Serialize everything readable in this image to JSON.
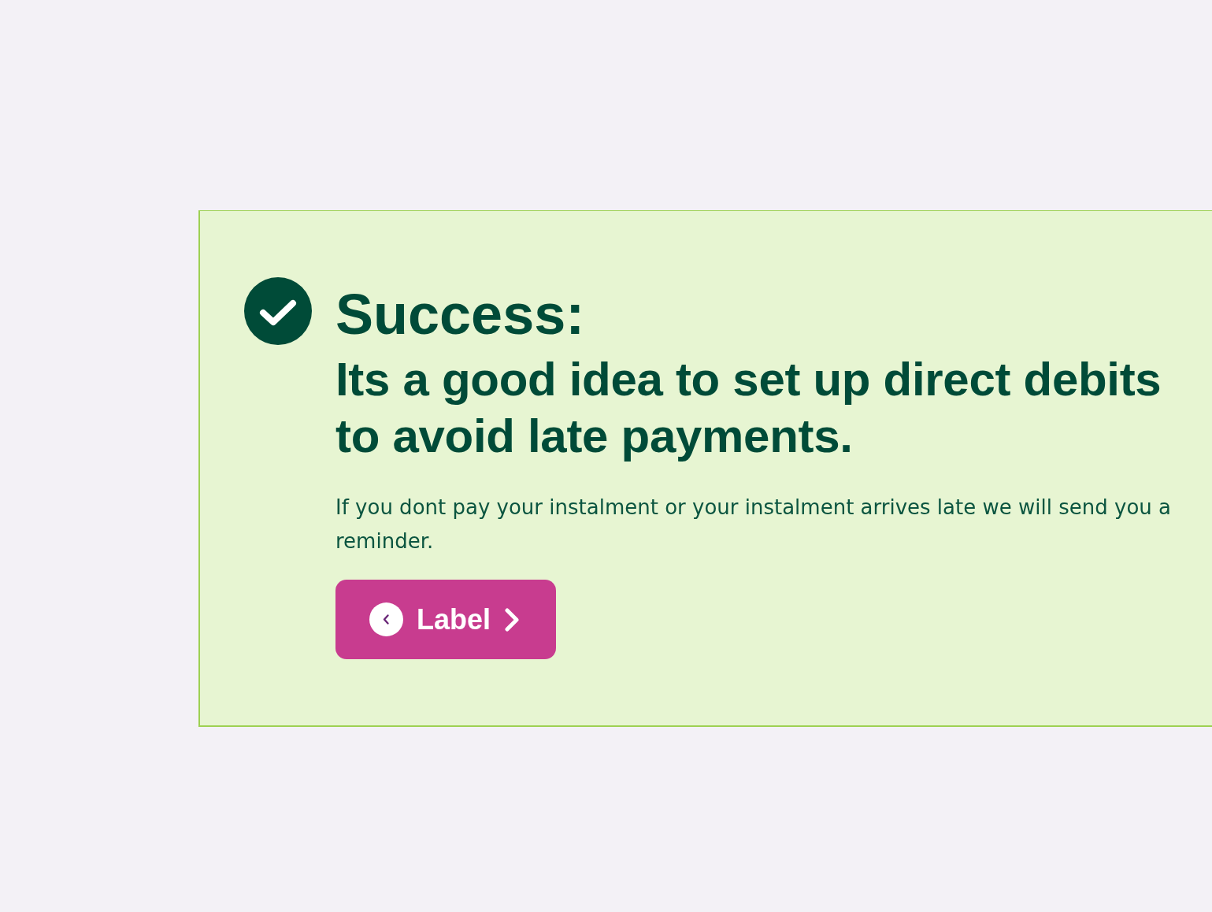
{
  "alert": {
    "kind": "success",
    "title": "Success:",
    "heading": "Its a good idea to set up direct debits to avoid late payments.",
    "message": "If you dont pay your instalment or your instalment arrives late we will send you a reminder.",
    "button": {
      "label": "Label"
    }
  }
}
